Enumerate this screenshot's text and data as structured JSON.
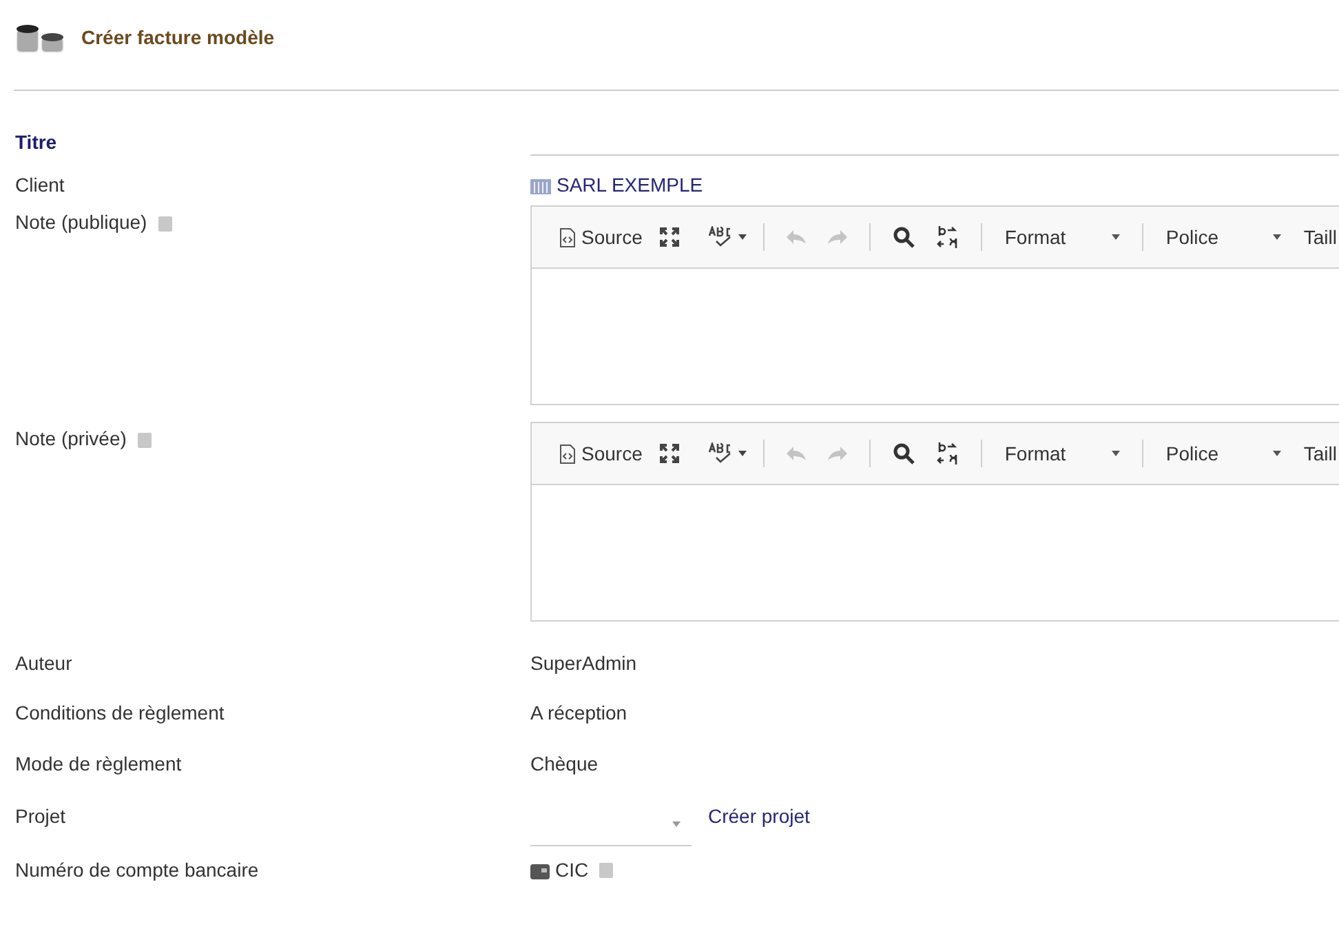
{
  "page": {
    "title": "Créer facture modèle"
  },
  "form": {
    "title_label": "Titre",
    "client": {
      "label": "Client",
      "value": "SARL EXEMPLE"
    },
    "editors": [
      {
        "label": "Note (publique)",
        "help": true,
        "toolbar": [
          {
            "kind": "source",
            "label": "Source"
          },
          {
            "kind": "maximize"
          },
          {
            "kind": "spellcheck"
          },
          {
            "kind": "separator"
          },
          {
            "kind": "undo",
            "disabled": true
          },
          {
            "kind": "redo",
            "disabled": true
          },
          {
            "kind": "separator"
          },
          {
            "kind": "find"
          },
          {
            "kind": "replace"
          },
          {
            "kind": "separator"
          },
          {
            "kind": "combo",
            "label": "Format"
          },
          {
            "kind": "separator"
          },
          {
            "kind": "combo",
            "label": "Police"
          },
          {
            "kind": "combo",
            "label": "Taill"
          }
        ]
      },
      {
        "label": "Note (privée)",
        "help": true,
        "toolbar": [
          {
            "kind": "source",
            "label": "Source"
          },
          {
            "kind": "maximize"
          },
          {
            "kind": "spellcheck"
          },
          {
            "kind": "separator"
          },
          {
            "kind": "undo",
            "disabled": true
          },
          {
            "kind": "redo",
            "disabled": true
          },
          {
            "kind": "separator"
          },
          {
            "kind": "find"
          },
          {
            "kind": "replace"
          },
          {
            "kind": "separator"
          },
          {
            "kind": "combo",
            "label": "Format"
          },
          {
            "kind": "separator"
          },
          {
            "kind": "combo",
            "label": "Police"
          },
          {
            "kind": "combo",
            "label": "Taill"
          }
        ]
      }
    ],
    "fields": [
      {
        "label": "Auteur",
        "value": "SuperAdmin"
      },
      {
        "label": "Conditions de règlement",
        "value": "A réception"
      },
      {
        "label": "Mode de règlement",
        "value": "Chèque"
      }
    ],
    "project": {
      "label": "Projet",
      "link": "Créer projet"
    },
    "bank": {
      "label": "Numéro de compte bancaire",
      "value": "CIC",
      "help": true
    }
  }
}
